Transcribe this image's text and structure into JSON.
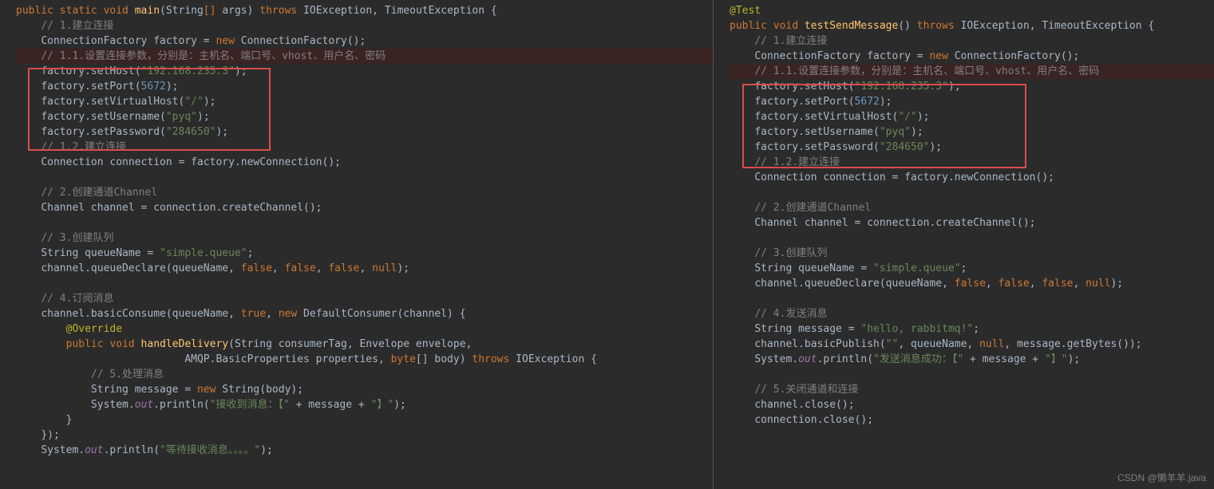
{
  "left": {
    "l1": {
      "a": "public static void ",
      "b": "main",
      "c": "(String",
      "d": "[] ",
      "e": "args) ",
      "f": "throws ",
      "g": "IOException, TimeoutException {"
    },
    "l2": "// 1.建立连接",
    "l3": {
      "a": "ConnectionFactory factory = ",
      "b": "new ",
      "c": "ConnectionFactory();"
    },
    "l4": "// 1.1.设置连接参数，分别是：主机名、端口号、vhost、用户名、密码",
    "l5": {
      "a": "factory.setHost(",
      "b": "\"192.168.235.3\"",
      "c": ");"
    },
    "l6": {
      "a": "factory.setPort(",
      "b": "5672",
      "c": ");"
    },
    "l7": {
      "a": "factory.setVirtualHost(",
      "b": "\"/\"",
      "c": ");"
    },
    "l8": {
      "a": "factory.setUsername(",
      "b": "\"pyq\"",
      "c": ");"
    },
    "l9": {
      "a": "factory.setPassword(",
      "b": "\"284650\"",
      "c": ");"
    },
    "l10": "// 1.2.建立连接",
    "l11": "Connection connection = factory.newConnection();",
    "l12": "",
    "l13": "// 2.创建通道Channel",
    "l14": "Channel channel = connection.createChannel();",
    "l15": "",
    "l16": "// 3.创建队列",
    "l17": {
      "a": "String queueName = ",
      "b": "\"simple.queue\"",
      "c": ";"
    },
    "l18": {
      "a": "channel.queueDeclare(queueName, ",
      "b": "false",
      "c": ", ",
      "d": "false",
      "e": ", ",
      "f": "false",
      "g": ", ",
      "h": "null",
      "i": ");"
    },
    "l19": "",
    "l20": "// 4.订阅消息",
    "l21": {
      "a": "channel.basicConsume(queueName, ",
      "b": "true",
      "c": ", ",
      "d": "new ",
      "e": "DefaultConsumer(channel) {"
    },
    "l22": "@Override",
    "l23": {
      "a": "public void ",
      "b": "handleDelivery",
      "c": "(String consumerTag, Envelope envelope,"
    },
    "l24": {
      "a": "                           AMQP.BasicProperties properties, ",
      "b": "byte",
      "c": "[] body) ",
      "d": "throws ",
      "e": "IOException {"
    },
    "l25": "// 5.处理消息",
    "l26": {
      "a": "String message = ",
      "b": "new ",
      "c": "String(body);"
    },
    "l27": {
      "a": "System.",
      "b": "out",
      "c": ".println(",
      "d": "\"接收到消息：【\" ",
      "e": "+ message + ",
      "f": "\"】\"",
      "g": ");"
    },
    "l28": "}",
    "l29": "});",
    "l30": {
      "a": "System.",
      "b": "out",
      "c": ".println(",
      "d": "\"等待接收消息。。。。\"",
      "e": ");"
    }
  },
  "right": {
    "r0": "@Test",
    "r1": {
      "a": "public void ",
      "b": "testSendMessage",
      "c": "() ",
      "d": "throws ",
      "e": "IOException, TimeoutException {"
    },
    "r2": "// 1.建立连接",
    "r3": {
      "a": "ConnectionFactory factory = ",
      "b": "new ",
      "c": "ConnectionFactory();"
    },
    "r4": "// 1.1.设置连接参数，分别是：主机名、端口号、vhost、用户名、密码",
    "r5": {
      "a": "factory.setHost(",
      "b": "\"192.168.235.3\"",
      "c": ");"
    },
    "r6": {
      "a": "factory.setPort(",
      "b": "5672",
      "c": ");"
    },
    "r7": {
      "a": "factory.setVirtualHost(",
      "b": "\"/\"",
      "c": ");"
    },
    "r8": {
      "a": "factory.setUsername(",
      "b": "\"pyq\"",
      "c": ");"
    },
    "r9": {
      "a": "factory.setPassword(",
      "b": "\"284650\"",
      "c": ");"
    },
    "r10": "// 1.2.建立连接",
    "r11": "Connection connection = factory.newConnection();",
    "r12": "",
    "r13": "// 2.创建通道Channel",
    "r14": "Channel channel = connection.createChannel();",
    "r15": "",
    "r16": "// 3.创建队列",
    "r17": {
      "a": "String queueName = ",
      "b": "\"simple.queue\"",
      "c": ";"
    },
    "r18": {
      "a": "channel.queueDeclare(queueName, ",
      "b": "false",
      "c": ", ",
      "d": "false",
      "e": ", ",
      "f": "false",
      "g": ", ",
      "h": "null",
      "i": ");"
    },
    "r19": "",
    "r20": "// 4.发送消息",
    "r21": {
      "a": "String message = ",
      "b": "\"hello, rabbitmq!\"",
      "c": ";"
    },
    "r22": {
      "a": "channel.basicPublish(",
      "b": "\"\"",
      "c": ", queueName, ",
      "d": "null",
      "e": ", message.getBytes());"
    },
    "r23": {
      "a": "System.",
      "b": "out",
      "c": ".println(",
      "d": "\"发送消息成功：【\" ",
      "e": "+ message + ",
      "f": "\"】\"",
      "g": ");"
    },
    "r24": "",
    "r25": "// 5.关闭通道和连接",
    "r26": "channel.close();",
    "r27": "connection.close();"
  },
  "watermark": "CSDN @懒羊羊.java"
}
